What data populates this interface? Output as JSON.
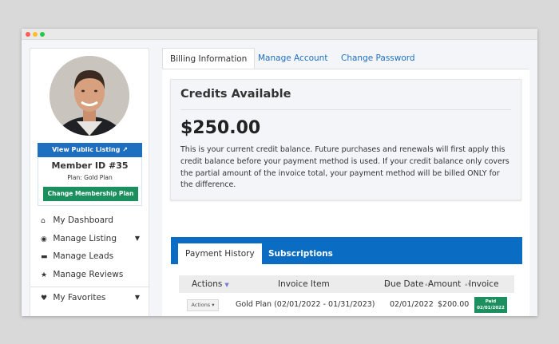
{
  "sidebar": {
    "view_listing_label": "View Public Listing",
    "member_id": "Member ID #35",
    "plan": "Plan: Gold Plan",
    "change_plan_label": "Change Membership Plan",
    "nav": [
      {
        "label": "My Dashboard",
        "icon": "home-icon"
      },
      {
        "label": "Manage Listing",
        "icon": "user-circle-icon",
        "has_caret": true
      },
      {
        "label": "Manage Leads",
        "icon": "folder-open-icon"
      },
      {
        "label": "Manage Reviews",
        "icon": "star-icon"
      },
      {
        "label": "My Favorites",
        "icon": "heart-icon",
        "has_caret": true
      }
    ]
  },
  "tabs": [
    {
      "label": "Billing Information",
      "active": true
    },
    {
      "label": "Manage Account",
      "active": false
    },
    {
      "label": "Change Password",
      "active": false
    }
  ],
  "credits": {
    "title": "Credits Available",
    "amount": "$250.00",
    "description": "This is your current credit balance. Future purchases and renewals will first apply this credit balance before your payment method is used. If your credit balance only covers the partial amount of the invoice total, your payment method will be billed ONLY for the difference."
  },
  "history": {
    "tabs": [
      {
        "label": "Payment History",
        "active": true
      },
      {
        "label": "Subscriptions",
        "active": false
      }
    ],
    "columns": [
      "Actions",
      "Invoice Item",
      "Due Date",
      "Amount",
      "Invoice"
    ],
    "rows": [
      {
        "actions_label": "Actions",
        "item": "Gold Plan (02/01/2022 - 01/31/2023)",
        "due_date": "02/01/2022",
        "amount": "$200.00",
        "status_line1": "Paid",
        "status_line2": "02/01/2022"
      }
    ]
  },
  "colors": {
    "primary": "#1f6fc0",
    "success": "#1b8f5e",
    "bar": "#0a6cc2"
  }
}
